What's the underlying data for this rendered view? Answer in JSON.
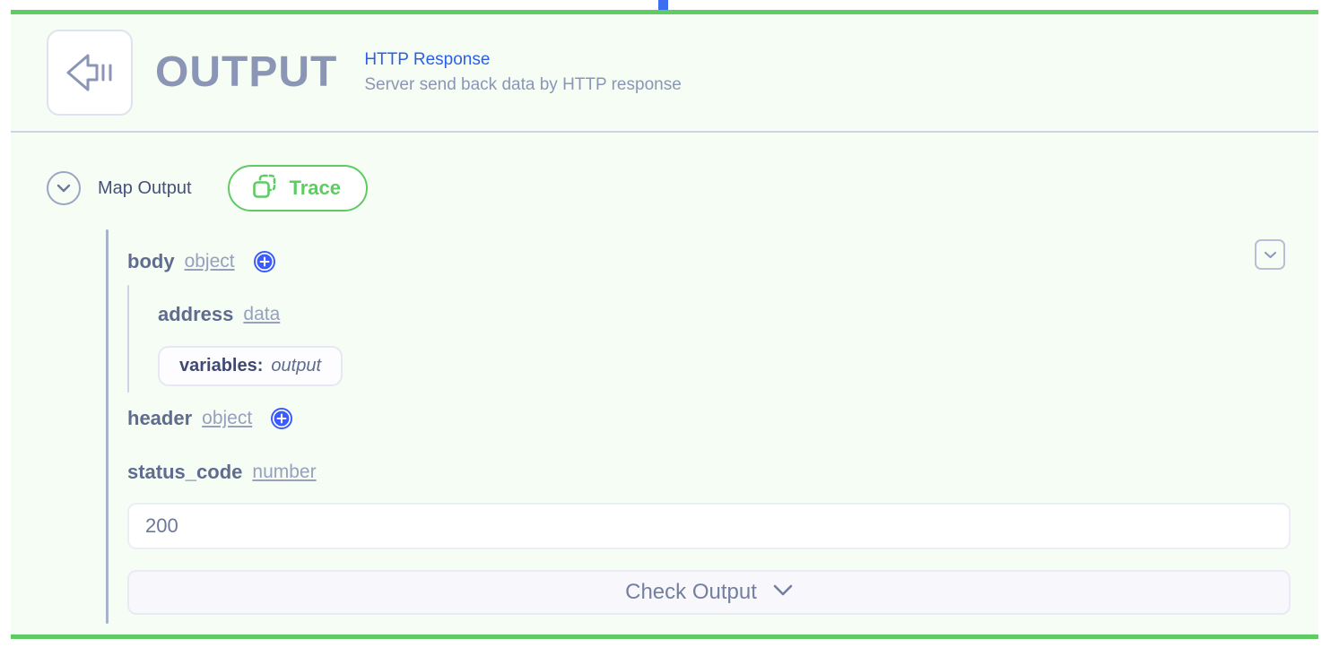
{
  "theme": {
    "accent_green": "#5ecb63",
    "accent_blue": "#3b5bfd",
    "link_blue": "#2b5fe8",
    "slate": "#8b96b6",
    "panel_bg": "#f6fdf4"
  },
  "node": {
    "icon": "output-arrow-icon",
    "title": "OUTPUT",
    "subtitle": "HTTP Response",
    "description": "Server send back data by HTTP response"
  },
  "toolbar": {
    "expand_icon": "chevron-down-circle-icon",
    "map_output_label": "Map Output",
    "trace": {
      "label": "Trace",
      "icon": "duplicate-icon"
    }
  },
  "collapse_button": {
    "icon": "chevron-down-icon"
  },
  "schema": {
    "fields": [
      {
        "name": "body",
        "type": "object",
        "add_button": "add-field-button",
        "add_icon": "plus-circle-icon"
      },
      {
        "name": "address",
        "type": "data"
      },
      {
        "name": "header",
        "type": "object",
        "add_button": "add-field-button",
        "add_icon": "plus-circle-icon"
      },
      {
        "name": "status_code",
        "type": "number"
      }
    ],
    "variable_pill": {
      "key": "variables:",
      "value": "output"
    }
  },
  "value_field": {
    "value": "200",
    "placeholder": "200"
  },
  "check_output": {
    "label": "Check Output",
    "icon": "chevron-down-icon"
  }
}
